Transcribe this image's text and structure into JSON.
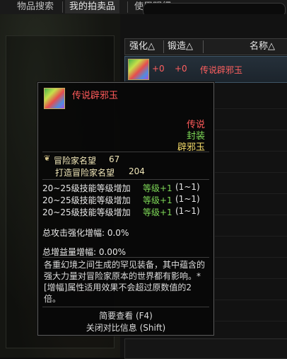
{
  "tabs": [
    {
      "label": "物品搜索"
    },
    {
      "label": "我的拍卖品"
    },
    {
      "label": "使用明细"
    }
  ],
  "columns": {
    "enhance": "强化△",
    "forge": "锻造△",
    "name": "名称△"
  },
  "listing": {
    "enhance": "+0",
    "forge": "+0",
    "name": "传说辟邪玉"
  },
  "tooltip": {
    "title": "传说辟邪玉",
    "rarity": "传说",
    "seal": "封装",
    "category": "辟邪玉",
    "fame_label": "冒险家名望",
    "fame_value": "67",
    "craft_fame_label": "打造冒险家名望",
    "craft_fame_value": "204",
    "skill_lines": [
      {
        "text": "20~25级技能等级增加",
        "bonus": "等级+1",
        "range": "(1~1)"
      },
      {
        "text": "20~25级技能等级增加",
        "bonus": "等级+1",
        "range": "(1~1)"
      },
      {
        "text": "20~25级技能等级增加",
        "bonus": "等级+1",
        "range": "(1~1)"
      }
    ],
    "attack_amp": "总攻击强化增幅: 0.0%",
    "gain_amp": "总增益量增幅: 0.00%",
    "description": "各重幻境之间生成的罕见装备，其中蕴含的强大力量对冒险家原本的世界都有影响。*[增幅]属性适用效果不会超过原数值的2倍。",
    "footer_brief": "简要查看 (F4)",
    "footer_compare": "关闭对比信息 (Shift)"
  },
  "colors": {
    "legendary_red": "#ff5a5a",
    "seal_green": "#7ed957",
    "category_gold": "#f6dc6a"
  },
  "icons": {
    "item": "gem-icon",
    "fame": "crest-icon"
  }
}
